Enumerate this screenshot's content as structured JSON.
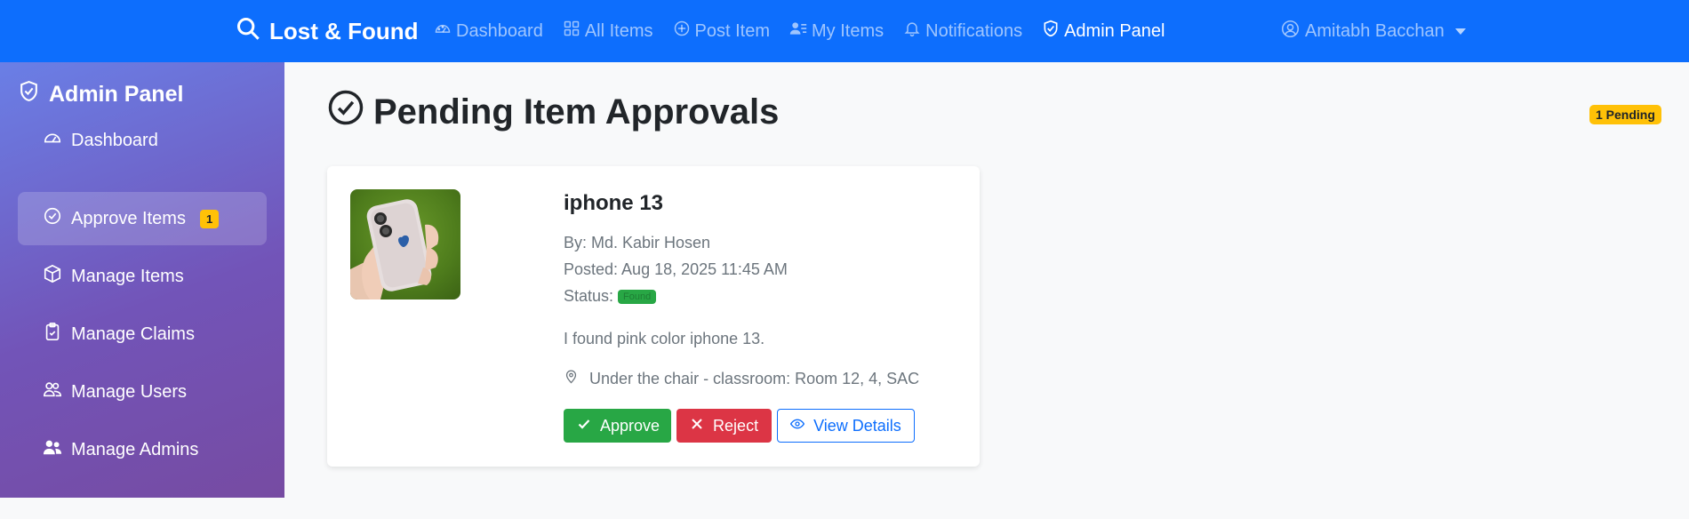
{
  "navbar": {
    "brand": "Lost & Found",
    "links": [
      {
        "label": "Dashboard",
        "icon": "speedometer-icon"
      },
      {
        "label": "All Items",
        "icon": "grid-icon"
      },
      {
        "label": "Post Item",
        "icon": "plus-circle-icon"
      },
      {
        "label": "My Items",
        "icon": "person-lines-icon"
      },
      {
        "label": "Notifications",
        "icon": "bell-icon"
      },
      {
        "label": "Admin Panel",
        "icon": "shield-check-icon",
        "active": true
      }
    ],
    "user": "Amitabh Bacchan"
  },
  "sidebar": {
    "title": "Admin Panel",
    "items": [
      {
        "label": "Dashboard",
        "icon": "speedometer-icon"
      },
      {
        "label": "Approve Items",
        "icon": "check-circle-icon",
        "active": true,
        "badge": "1"
      },
      {
        "label": "Manage Items",
        "icon": "box-icon"
      },
      {
        "label": "Manage Claims",
        "icon": "clipboard-check-icon"
      },
      {
        "label": "Manage Users",
        "icon": "people-icon"
      },
      {
        "label": "Manage Admins",
        "icon": "people-fill-icon"
      }
    ]
  },
  "main": {
    "title": "Pending Item Approvals",
    "pending_badge": "1 Pending",
    "card": {
      "title": "iphone 13",
      "by": "By: Md. Kabir Hosen",
      "posted": "Posted: Aug 18, 2025 11:45 AM",
      "status_label": "Status:",
      "status_value": "Found",
      "description": "I found pink color iphone 13.",
      "location": "Under the chair - classroom: Room 12, 4, SAC",
      "approve": "Approve",
      "reject": "Reject",
      "view": "View Details"
    }
  },
  "colors": {
    "primary": "#0d6efd",
    "success": "#28a745",
    "danger": "#dc3545",
    "warning": "#ffc107"
  }
}
